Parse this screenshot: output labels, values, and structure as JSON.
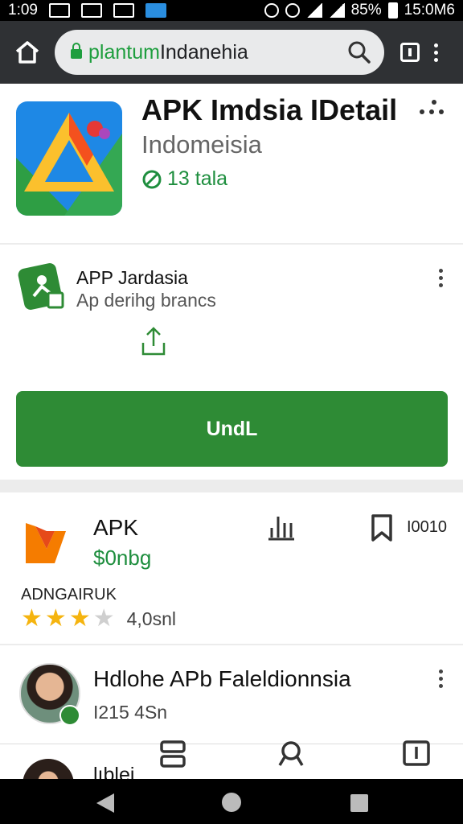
{
  "statusbar": {
    "time": "1:09",
    "battery": "85%",
    "clock": "15:0M6"
  },
  "browser": {
    "url_green": "plantum",
    "url_rest": "Indanehia"
  },
  "app": {
    "title": "APK Imdsia IDetail",
    "subtitle": "Indomeisia",
    "meta": "13 tala"
  },
  "card2": {
    "name": "APP Jardasia",
    "desc": "Ap derihg brancs",
    "install_label": "UndL"
  },
  "card3": {
    "name": "APK",
    "price": "$0nbg",
    "count": "I0010",
    "publisher": "ADNGAIRUK",
    "stars": "★★★★",
    "rating": "4,0snl"
  },
  "card4": {
    "name": "Hdlohe APb Faleldionnsia",
    "sub": "I215 4Sn"
  },
  "peek": {
    "text": "lıblei.."
  },
  "colors": {
    "accent_green": "#2e8b35",
    "link_green": "#1e8e3e",
    "star": "#f5b40f"
  }
}
